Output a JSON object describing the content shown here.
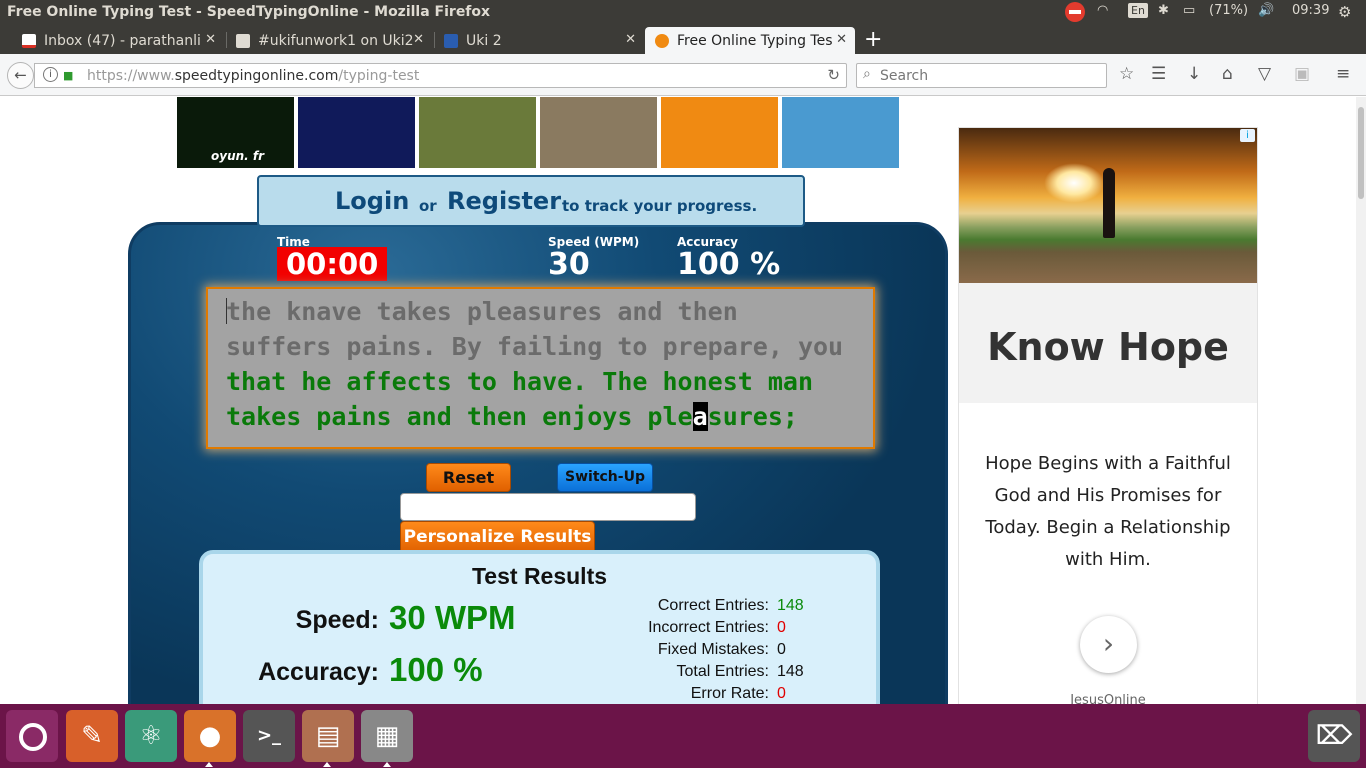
{
  "window": {
    "title": "Free Online Typing Test - SpeedTypingOnline - Mozilla Firefox"
  },
  "system_tray": {
    "keyboard_layout": "En",
    "battery_text": "(71%)",
    "clock": "09:39"
  },
  "tabs": [
    {
      "label": "Inbox (47) - parathanli",
      "favicon": "gmail-icon",
      "active": false
    },
    {
      "label": "#ukifunwork1 on Uki2",
      "favicon": "slack-icon",
      "active": false
    },
    {
      "label": "Uki 2",
      "favicon": "uki-icon",
      "active": false
    },
    {
      "label": "Free Online Typing Tes",
      "favicon": "speedtyping-icon",
      "active": true
    }
  ],
  "address_bar": {
    "url_prefix": "https://www.",
    "url_domain": "speedtypingonline.com",
    "url_path": "/typing-test",
    "search_placeholder": "Search"
  },
  "thumbnails": [
    {
      "name": "game-thumb-oyun",
      "caption": "oyun. fr"
    },
    {
      "name": "game-thumb-blue"
    },
    {
      "name": "game-thumb-run"
    },
    {
      "name": "game-thumb-shooter"
    },
    {
      "name": "game-thumb-basket"
    },
    {
      "name": "game-thumb-soccer"
    }
  ],
  "login_banner": {
    "login": "Login",
    "or": "or",
    "register": "Register",
    "track": "to track your progress."
  },
  "stats": {
    "time_label": "Time",
    "time_value": "00:00",
    "speed_label": "Speed (WPM)",
    "speed_value": "30",
    "accuracy_label": "Accuracy",
    "accuracy_value": "100 %"
  },
  "typing_text": {
    "line1": "the knave takes pleasures and then",
    "line2": "suffers pains. By failing to prepare, you",
    "line3": "that he affects to have. The honest man",
    "line4_before": "takes pains and then enjoys ple",
    "line4_cursor": "a",
    "line4_after": "sures;"
  },
  "controls": {
    "reset": "Reset",
    "switch_up": "Switch-Up",
    "personalize": "Personalize Results"
  },
  "results": {
    "title": "Test Results",
    "speed_label": "Speed:",
    "speed_value": "30 WPM",
    "accuracy_label": "Accuracy:",
    "accuracy_value": "100 %",
    "details": [
      {
        "label": "Correct Entries:",
        "value": "148",
        "color": "#0a8a0a"
      },
      {
        "label": "Incorrect Entries:",
        "value": "0",
        "color": "#e00000"
      },
      {
        "label": "Fixed Mistakes:",
        "value": "0",
        "color": "#111111"
      },
      {
        "label": "Total Entries:",
        "value": "148",
        "color": "#111111"
      },
      {
        "label": "Error Rate:",
        "value": "0",
        "color": "#e00000"
      }
    ]
  },
  "ad": {
    "headline": "Know Hope",
    "body": "Hope Begins with a Faithful God and His Promises for Today. Begin a Relationship with Him.",
    "source": "JesusOnline"
  },
  "launcher": [
    {
      "name": "launcher-ubuntu-icon"
    },
    {
      "name": "launcher-pen-icon"
    },
    {
      "name": "launcher-atom-icon"
    },
    {
      "name": "launcher-firefox-icon"
    },
    {
      "name": "launcher-terminal-icon"
    },
    {
      "name": "launcher-files-icon"
    },
    {
      "name": "launcher-video-icon"
    },
    {
      "name": "launcher-trash-icon"
    }
  ]
}
